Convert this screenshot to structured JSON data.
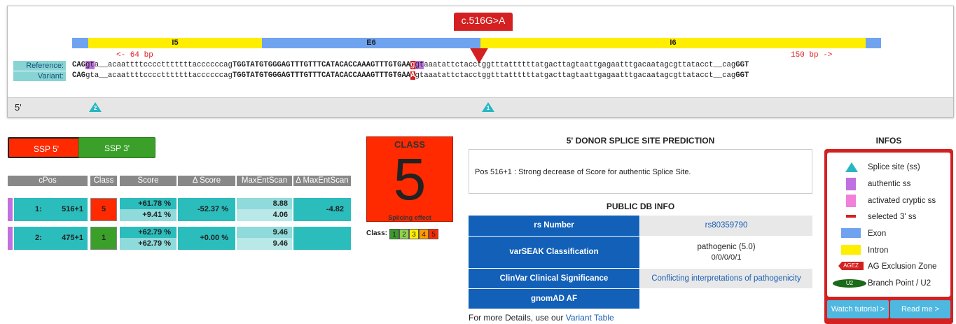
{
  "variant": {
    "label": "c.516G>A"
  },
  "tracks": [
    {
      "label": "",
      "kind": "exon"
    },
    {
      "label": "I5",
      "kind": "intron"
    },
    {
      "label": "E6",
      "kind": "exon"
    },
    {
      "label": "I6",
      "kind": "intron"
    },
    {
      "label": "",
      "kind": "exon"
    }
  ],
  "distances": {
    "left": "<- 64 bp",
    "right": "150 bp ->"
  },
  "sequence": {
    "reference_label": "Reference:",
    "variant_label": "Variant:",
    "reference_pre": "CAG",
    "reference_hl1": "gt",
    "reference_mid": "a__acaattttcccctttttttaccccccag",
    "reference_exon": "TGGTATGTGGGAGTTTGTTTCATACACCAAAGTTTGTGAA",
    "reference_var": "g",
    "reference_hl2": "gt",
    "reference_post": "aaatattctacctggtttattttttatgacttagtaattgagaatttgacaatagcgttatacct__cag",
    "reference_end": "GGT",
    "variant_pre": "CAG",
    "variant_mid": "gta__acaattttcccctttttttaccccccag",
    "variant_exon": "TGGTATGTGGGAGTTTGTTTCATACACCAAAGTTTGTGAA",
    "variant_var": "A",
    "variant_post": "gtaaatattctacctggtttattttttatgacttagtaattgagaatttgacaatagcgttatacct__cag",
    "variant_end": "GGT"
  },
  "footer": {
    "five_prime": "5'",
    "site1": "1",
    "site2": "2"
  },
  "ssp": {
    "btn5": "SSP 5'",
    "btn3": "SSP 3'"
  },
  "table": {
    "headers": [
      "cPos",
      "Class",
      "Score",
      "Δ Score",
      "MaxEntScan",
      "Δ MaxEntScan"
    ],
    "rows": [
      {
        "idx": "1:",
        "pos": "516+1",
        "class": "5",
        "score_a": "+61.78 %",
        "score_b": "+9.41 %",
        "dscore": "-52.37 %",
        "mes_a": "8.88",
        "mes_b": "4.06",
        "dmes": "-4.82"
      },
      {
        "idx": "2:",
        "pos": "475+1",
        "class": "1",
        "score_a": "+62.79 %",
        "score_b": "+62.79 %",
        "dscore": "+0.00 %",
        "mes_a": "9.46",
        "mes_b": "9.46",
        "dmes": ""
      }
    ]
  },
  "classbox": {
    "title": "CLASS",
    "value": "5",
    "subtitle": "Splicing effect",
    "legend_label": "Class:",
    "pills": [
      "1",
      "2",
      "3",
      "4",
      "5"
    ],
    "pill_colors": [
      "#3a9a2a",
      "#8fd14f",
      "#ffee00",
      "#ff9a00",
      "#ff2a00"
    ]
  },
  "prediction": {
    "title": "5' DONOR SPLICE SITE PREDICTION",
    "text": "Pos 516+1 : Strong decrease of Score for authentic Splice Site."
  },
  "publicdb": {
    "title": "PUBLIC DB INFO",
    "rows": [
      {
        "key": "rs Number",
        "value": "rs80359790"
      },
      {
        "key": "varSEAK Classification",
        "value": "pathogenic (5.0)",
        "value2": "0/0/0/0/1"
      },
      {
        "key": "ClinVar Clinical Significance",
        "value": "Conflicting interpretations of pathogenicity"
      },
      {
        "key": "gnomAD AF",
        "value": ""
      }
    ],
    "details_prefix": "For more Details, use our",
    "details_link": "Variant Table"
  },
  "infos": {
    "title": "INFOS",
    "legend": [
      "Splice site (ss)",
      "authentic ss",
      "activated cryptic ss",
      "selected 3' ss",
      "Exon",
      "Intron",
      "AG Exclusion Zone",
      "Branch Point / U2"
    ],
    "agez_label": "AGEZ",
    "u2_label": "U2",
    "btn_tutorial": "Watch tutorial >",
    "btn_readme": "Read me >"
  }
}
